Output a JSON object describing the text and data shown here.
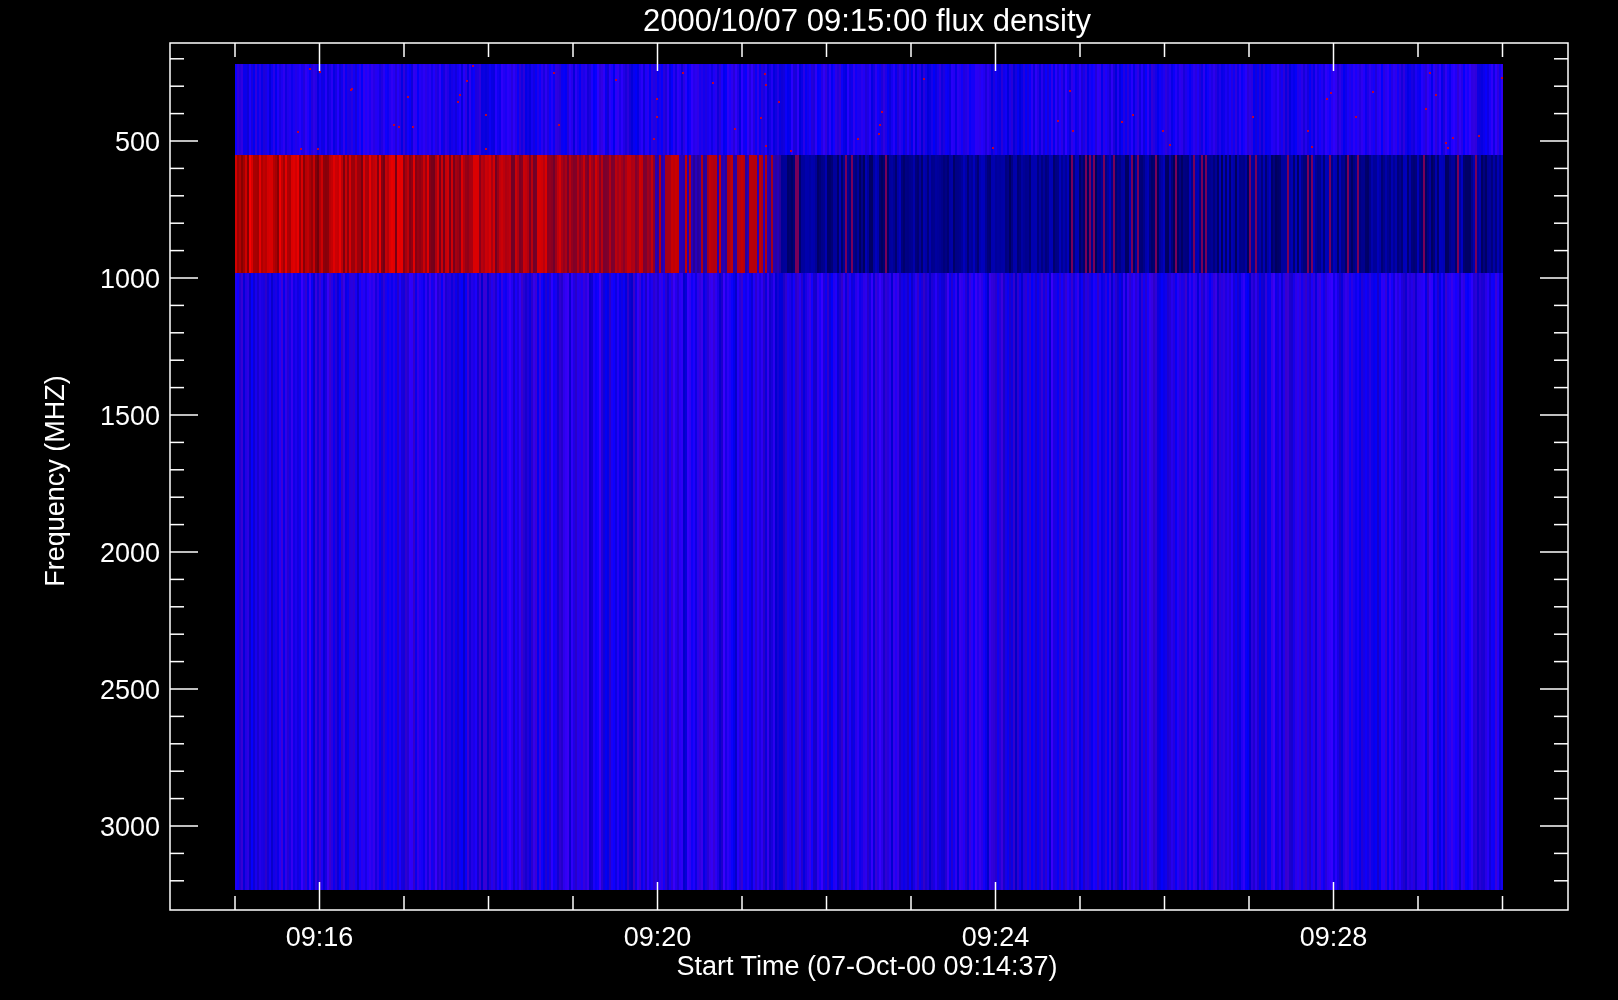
{
  "plot": {
    "title": "2000/10/07 09:15:00 flux density",
    "y_axis": {
      "label": "Frequency (MHZ)",
      "ticks": [
        "500",
        "1000",
        "1500",
        "2000",
        "2500",
        "3000"
      ]
    },
    "x_axis": {
      "label": "Start Time (07-Oct-00 09:14:37)",
      "ticks": [
        "09:16",
        "09:20",
        "09:24",
        "09:28"
      ]
    }
  }
}
